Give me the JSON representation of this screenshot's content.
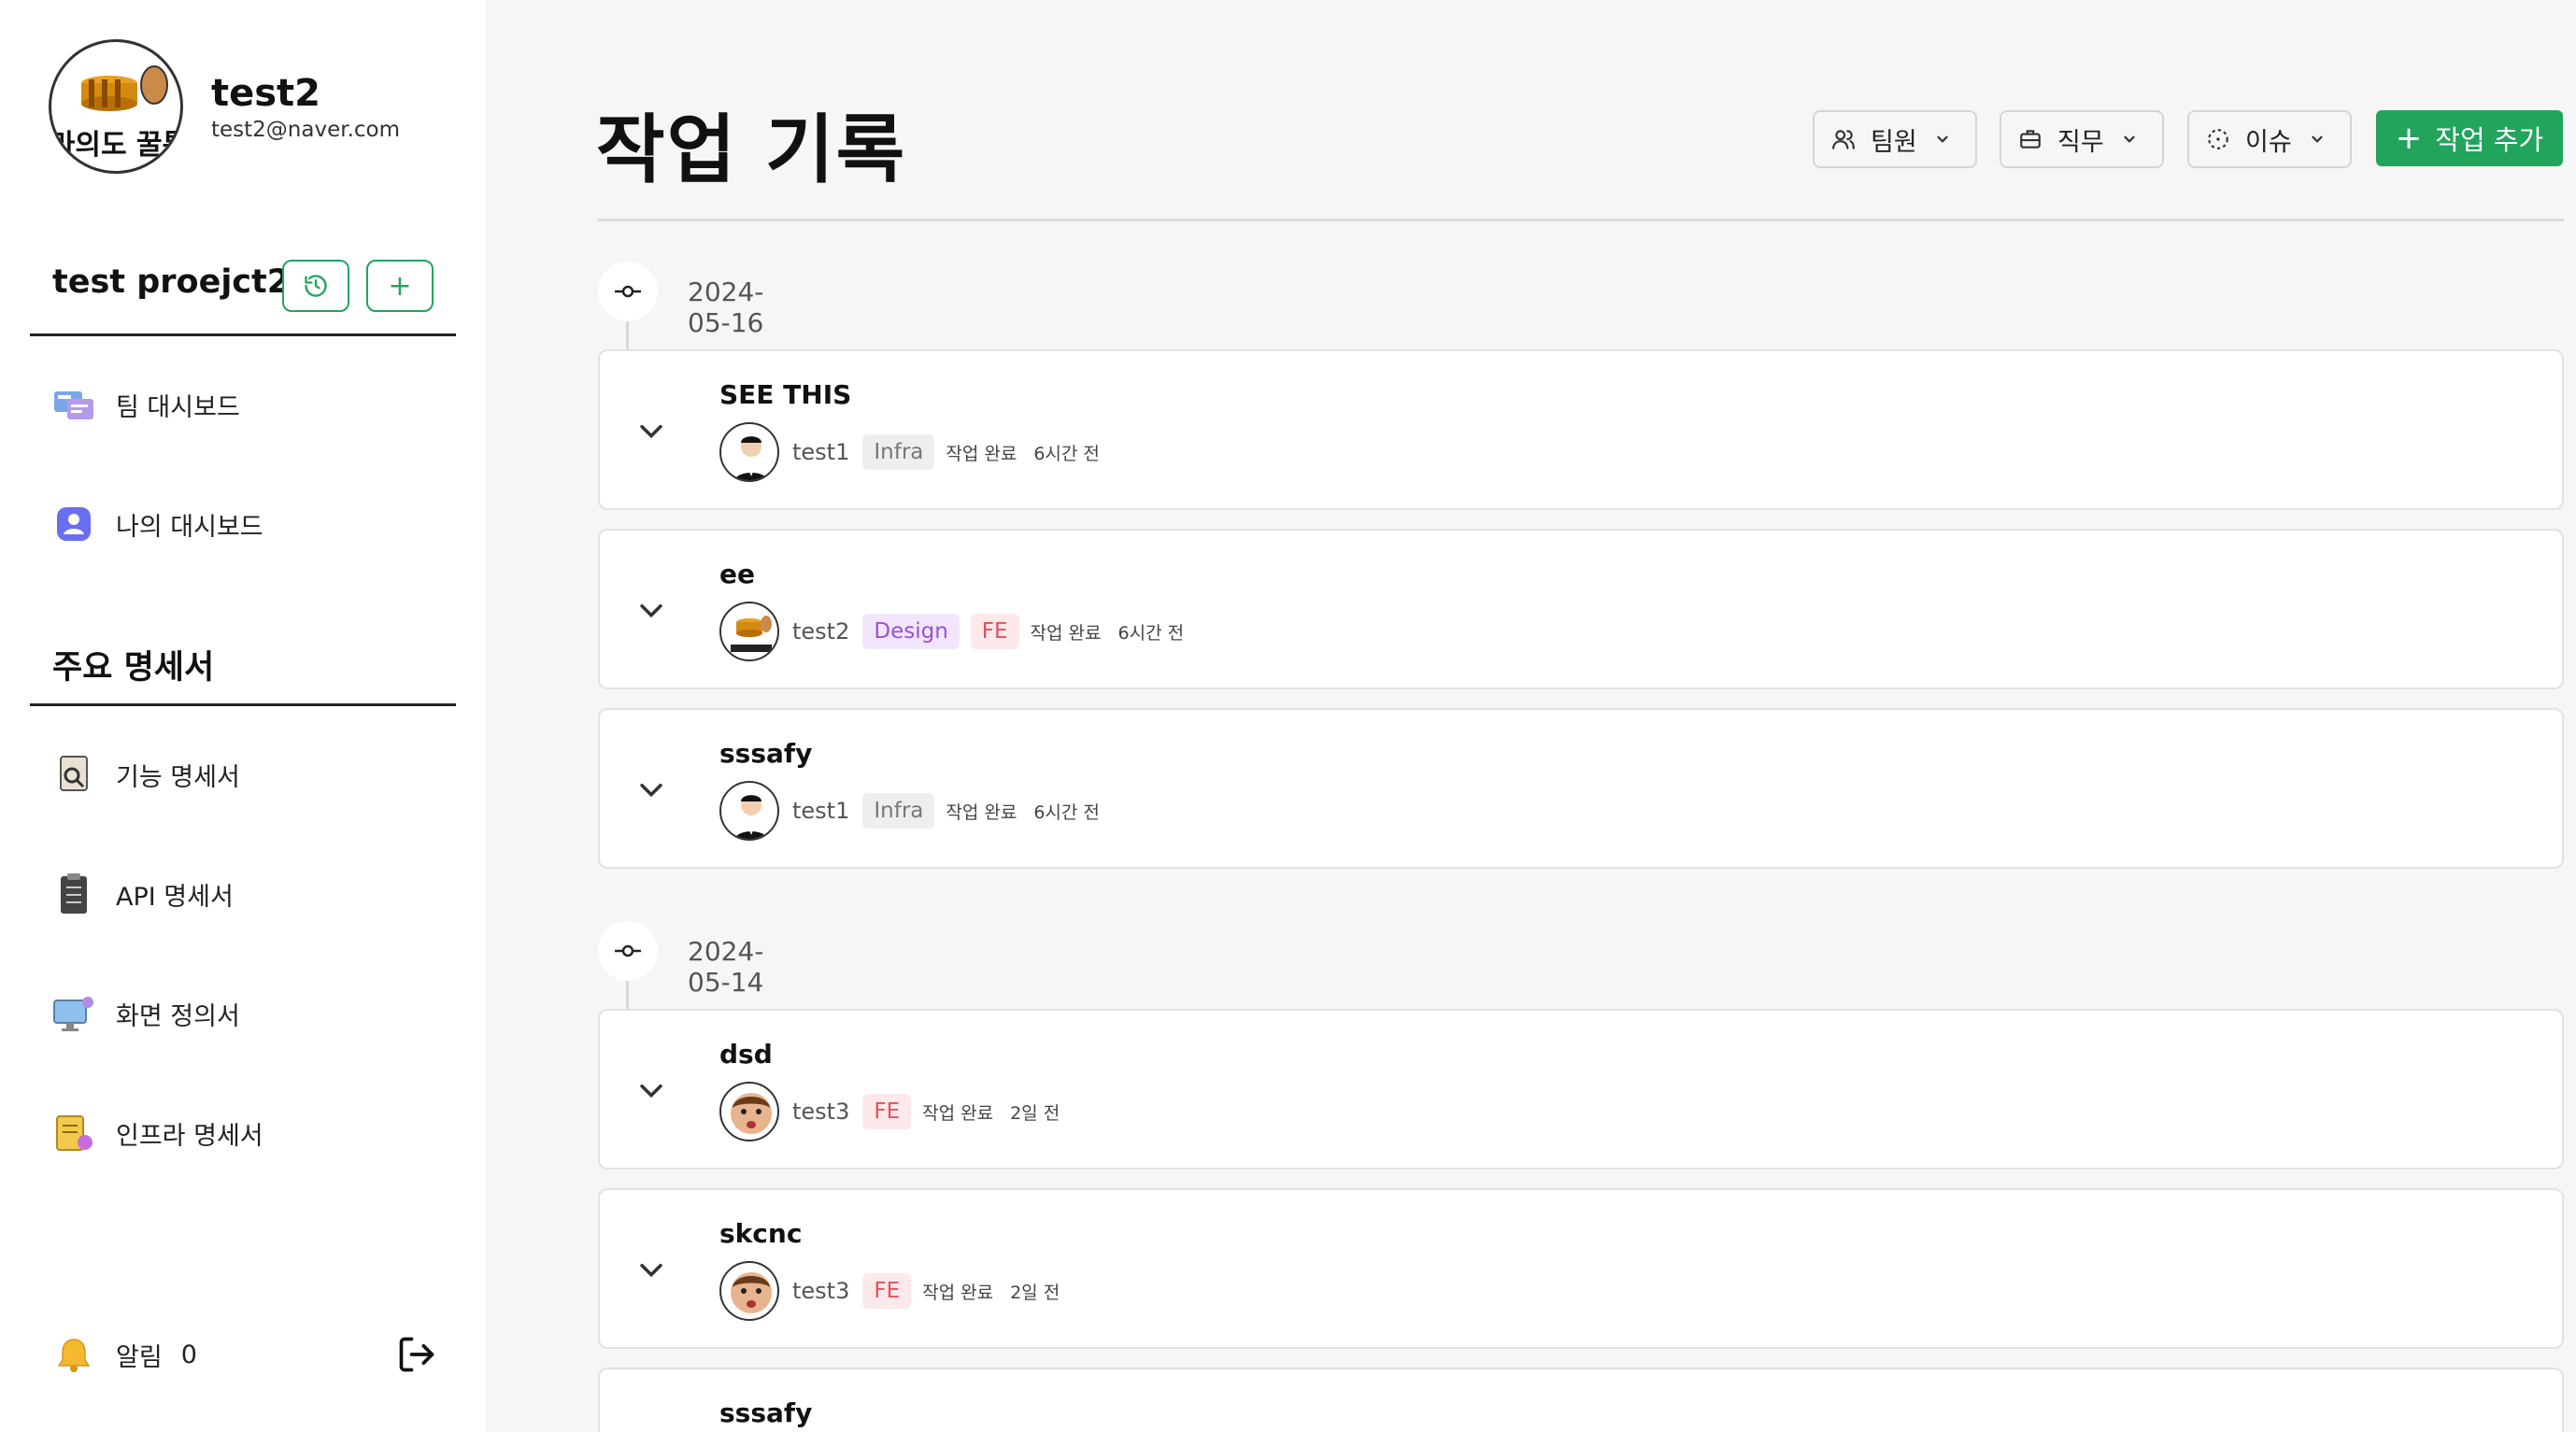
{
  "profile": {
    "name": "test2",
    "email": "test2@naver.com",
    "avatar_text": "라의도 꿀통"
  },
  "project": {
    "name": "test proejct2",
    "history_button": "history",
    "add_button": "+"
  },
  "nav": {
    "team_dashboard": "팀 대시보드",
    "my_dashboard": "나의 대시보드",
    "section_title": "주요 명세서",
    "feature_spec": "기능 명세서",
    "api_spec": "API 명세서",
    "screen_def": "화면 정의서",
    "infra_spec": "인프라 명세서"
  },
  "notifications": {
    "label": "알림",
    "count": "0"
  },
  "page": {
    "title": "작업 기록"
  },
  "filters": {
    "member": "팀원",
    "role": "직무",
    "issue": "이슈"
  },
  "add_task": {
    "plus": "+",
    "label": "작업 추가"
  },
  "groups": [
    {
      "date": "2024-05-16",
      "items": [
        {
          "title": "SEE THIS",
          "user": "test1",
          "tags": [
            "Infra"
          ],
          "status": "작업 완료",
          "time": "6시간 전"
        },
        {
          "title": "ee",
          "user": "test2",
          "tags": [
            "Design",
            "FE"
          ],
          "status": "작업 완료",
          "time": "6시간 전"
        },
        {
          "title": "sssafy",
          "user": "test1",
          "tags": [
            "Infra"
          ],
          "status": "작업 완료",
          "time": "6시간 전"
        }
      ]
    },
    {
      "date": "2024-05-14",
      "items": [
        {
          "title": "dsd",
          "user": "test3",
          "tags": [
            "FE"
          ],
          "status": "작업 완료",
          "time": "2일 전"
        },
        {
          "title": "skcnc",
          "user": "test3",
          "tags": [
            "FE"
          ],
          "status": "작업 완료",
          "time": "2일 전"
        },
        {
          "title": "sssafy"
        }
      ]
    }
  ],
  "colors": {
    "accent": "#22a45d",
    "design_tag": "#9b4fd8",
    "fe_tag": "#e0505f",
    "infra_tag": "#777777"
  }
}
